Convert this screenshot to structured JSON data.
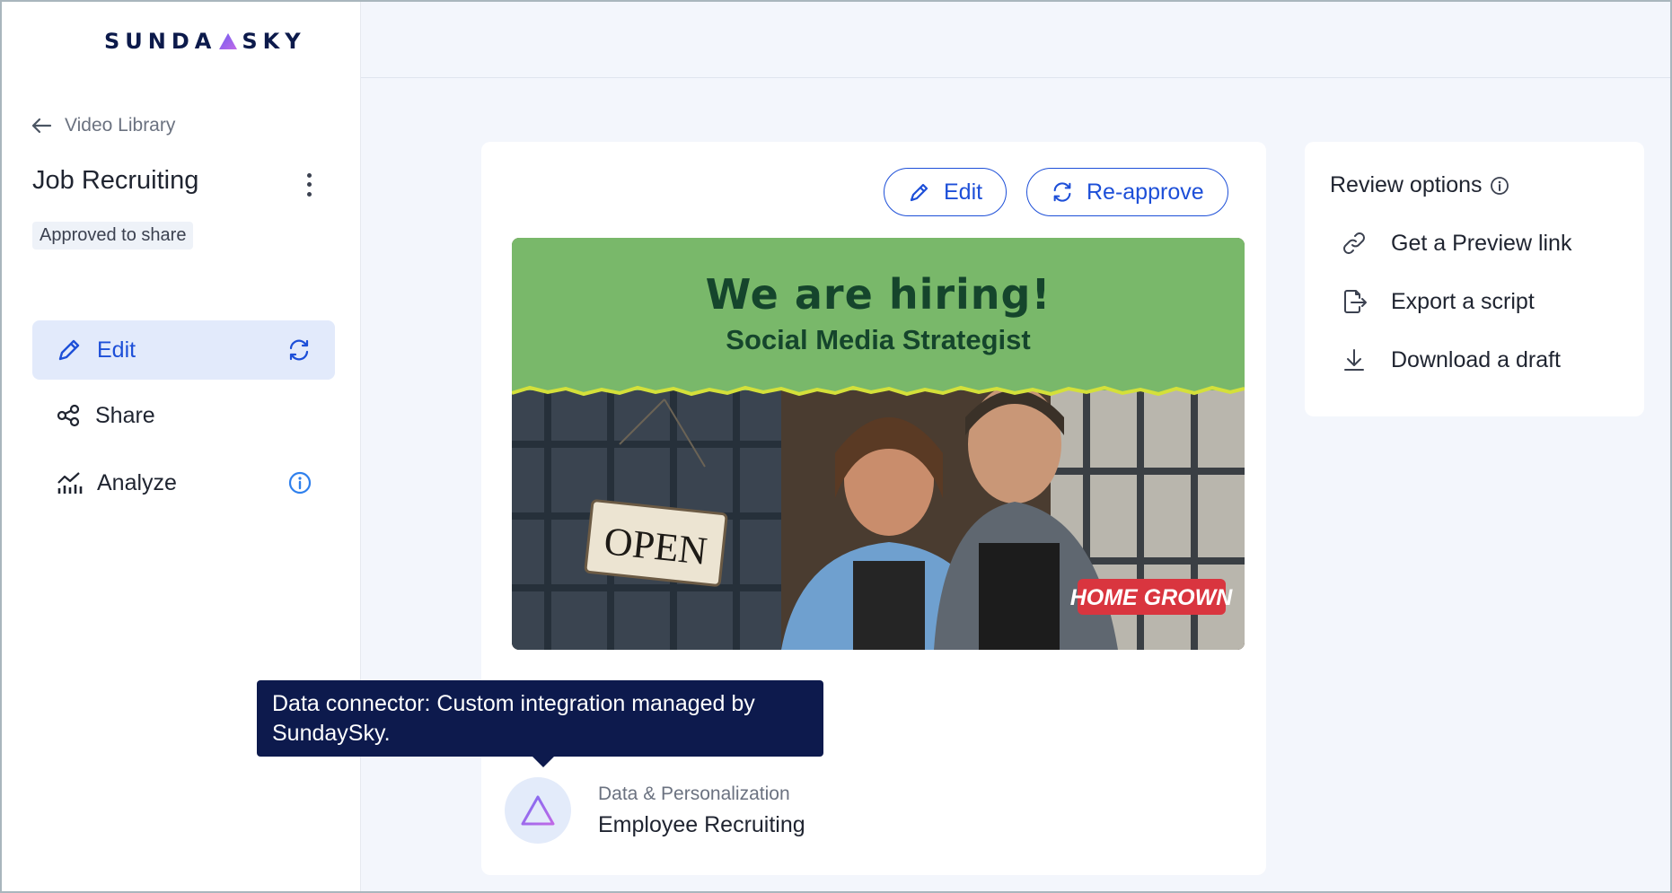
{
  "brand": {
    "logo_left": "SUNDA",
    "logo_right": "SKY",
    "accent": "#1d4fd8",
    "navy": "#0c1a4b"
  },
  "sidebar": {
    "back_label": "Video Library",
    "project_title": "Job Recruiting",
    "status": "Approved to share",
    "nav": [
      {
        "label": "Edit",
        "icon": "pencil-icon",
        "active": true
      },
      {
        "label": "Share",
        "icon": "share-icon"
      },
      {
        "label": "Analyze",
        "icon": "analytics-icon"
      }
    ]
  },
  "main": {
    "edit_button": "Edit",
    "reapprove_button": "Re-approve",
    "video": {
      "headline": "We are hiring!",
      "subheadline": "Social Media Strategist",
      "sign_text": "OPEN",
      "badge_text": "HOME GROWN"
    },
    "data": {
      "label": "Data & Personalization",
      "value": "Employee Recruiting"
    },
    "tooltip": "Data connector: Custom integration managed by SundaySky."
  },
  "review": {
    "title": "Review options",
    "items": [
      {
        "label": "Get a Preview link",
        "icon": "link-icon"
      },
      {
        "label": "Export a script",
        "icon": "export-icon"
      },
      {
        "label": "Download a draft",
        "icon": "download-icon"
      }
    ]
  }
}
